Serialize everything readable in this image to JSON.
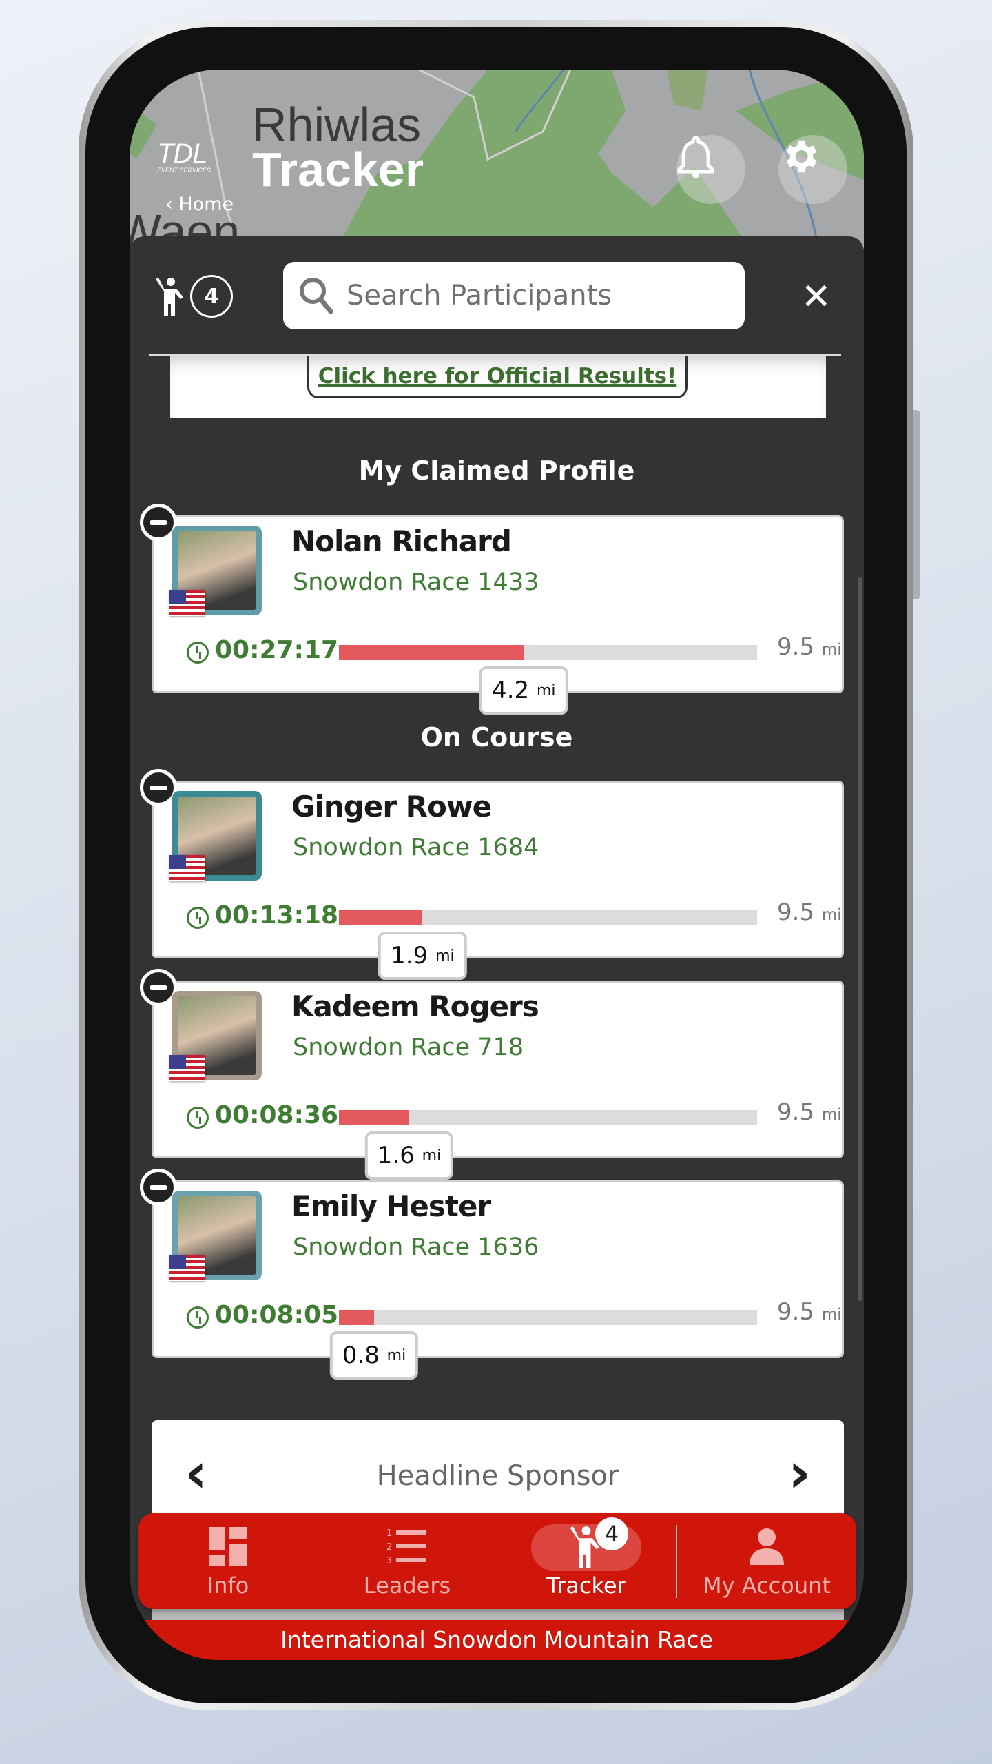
{
  "header": {
    "logo": "TDL",
    "logo_sub": "EVENT SERVICES",
    "map_place": "Rhiwlas",
    "map_place_2": "Waen",
    "title": "Tracker",
    "home_link": "Home",
    "icons": [
      "bell-icon",
      "gear-icon"
    ]
  },
  "search": {
    "tracked_count": "4",
    "placeholder": "Search Participants",
    "value": "",
    "close_icon": "close-icon"
  },
  "results_link": "Click here for Official Results!",
  "sections": {
    "claimed": "My Claimed Profile",
    "on_course": "On Course"
  },
  "colors": {
    "accent_red": "#d0160b",
    "progress_red": "#e45a5c",
    "race_green": "#3f7d34"
  },
  "claimed": [
    {
      "name": "Nolan Richard",
      "race": "Snowdon Race 1433",
      "time": "00:27:17",
      "distance": "4.2",
      "total": "9.5",
      "unit": "mi",
      "progress": 0.442,
      "country": "USA",
      "photo_bg": "#5f9ea7"
    }
  ],
  "on_course": [
    {
      "name": "Ginger Rowe",
      "race": "Snowdon Race 1684",
      "time": "00:13:18",
      "distance": "1.9",
      "total": "9.5",
      "unit": "mi",
      "progress": 0.2,
      "country": "USA",
      "photo_bg": "#3c8b94"
    },
    {
      "name": "Kadeem Rogers",
      "race": "Snowdon Race 718",
      "time": "00:08:36",
      "distance": "1.6",
      "total": "9.5",
      "unit": "mi",
      "progress": 0.168,
      "country": "USA",
      "photo_bg": "#a99a8c"
    },
    {
      "name": "Emily Hester",
      "race": "Snowdon Race 1636",
      "time": "00:08:05",
      "distance": "0.8",
      "total": "9.5",
      "unit": "mi",
      "progress": 0.084,
      "country": "USA",
      "photo_bg": "#6aa3ad"
    }
  ],
  "sponsor": {
    "label": "Headline Sponsor"
  },
  "nav": [
    {
      "label": "Info",
      "icon": "dashboard-icon",
      "active": false
    },
    {
      "label": "Leaders",
      "icon": "numbered-list-icon",
      "active": false
    },
    {
      "label": "Tracker",
      "icon": "waving-person-icon",
      "active": true,
      "badge": "4"
    },
    {
      "label": "My Account",
      "icon": "user-icon",
      "active": false
    }
  ],
  "footer": "International Snowdon Mountain Race"
}
